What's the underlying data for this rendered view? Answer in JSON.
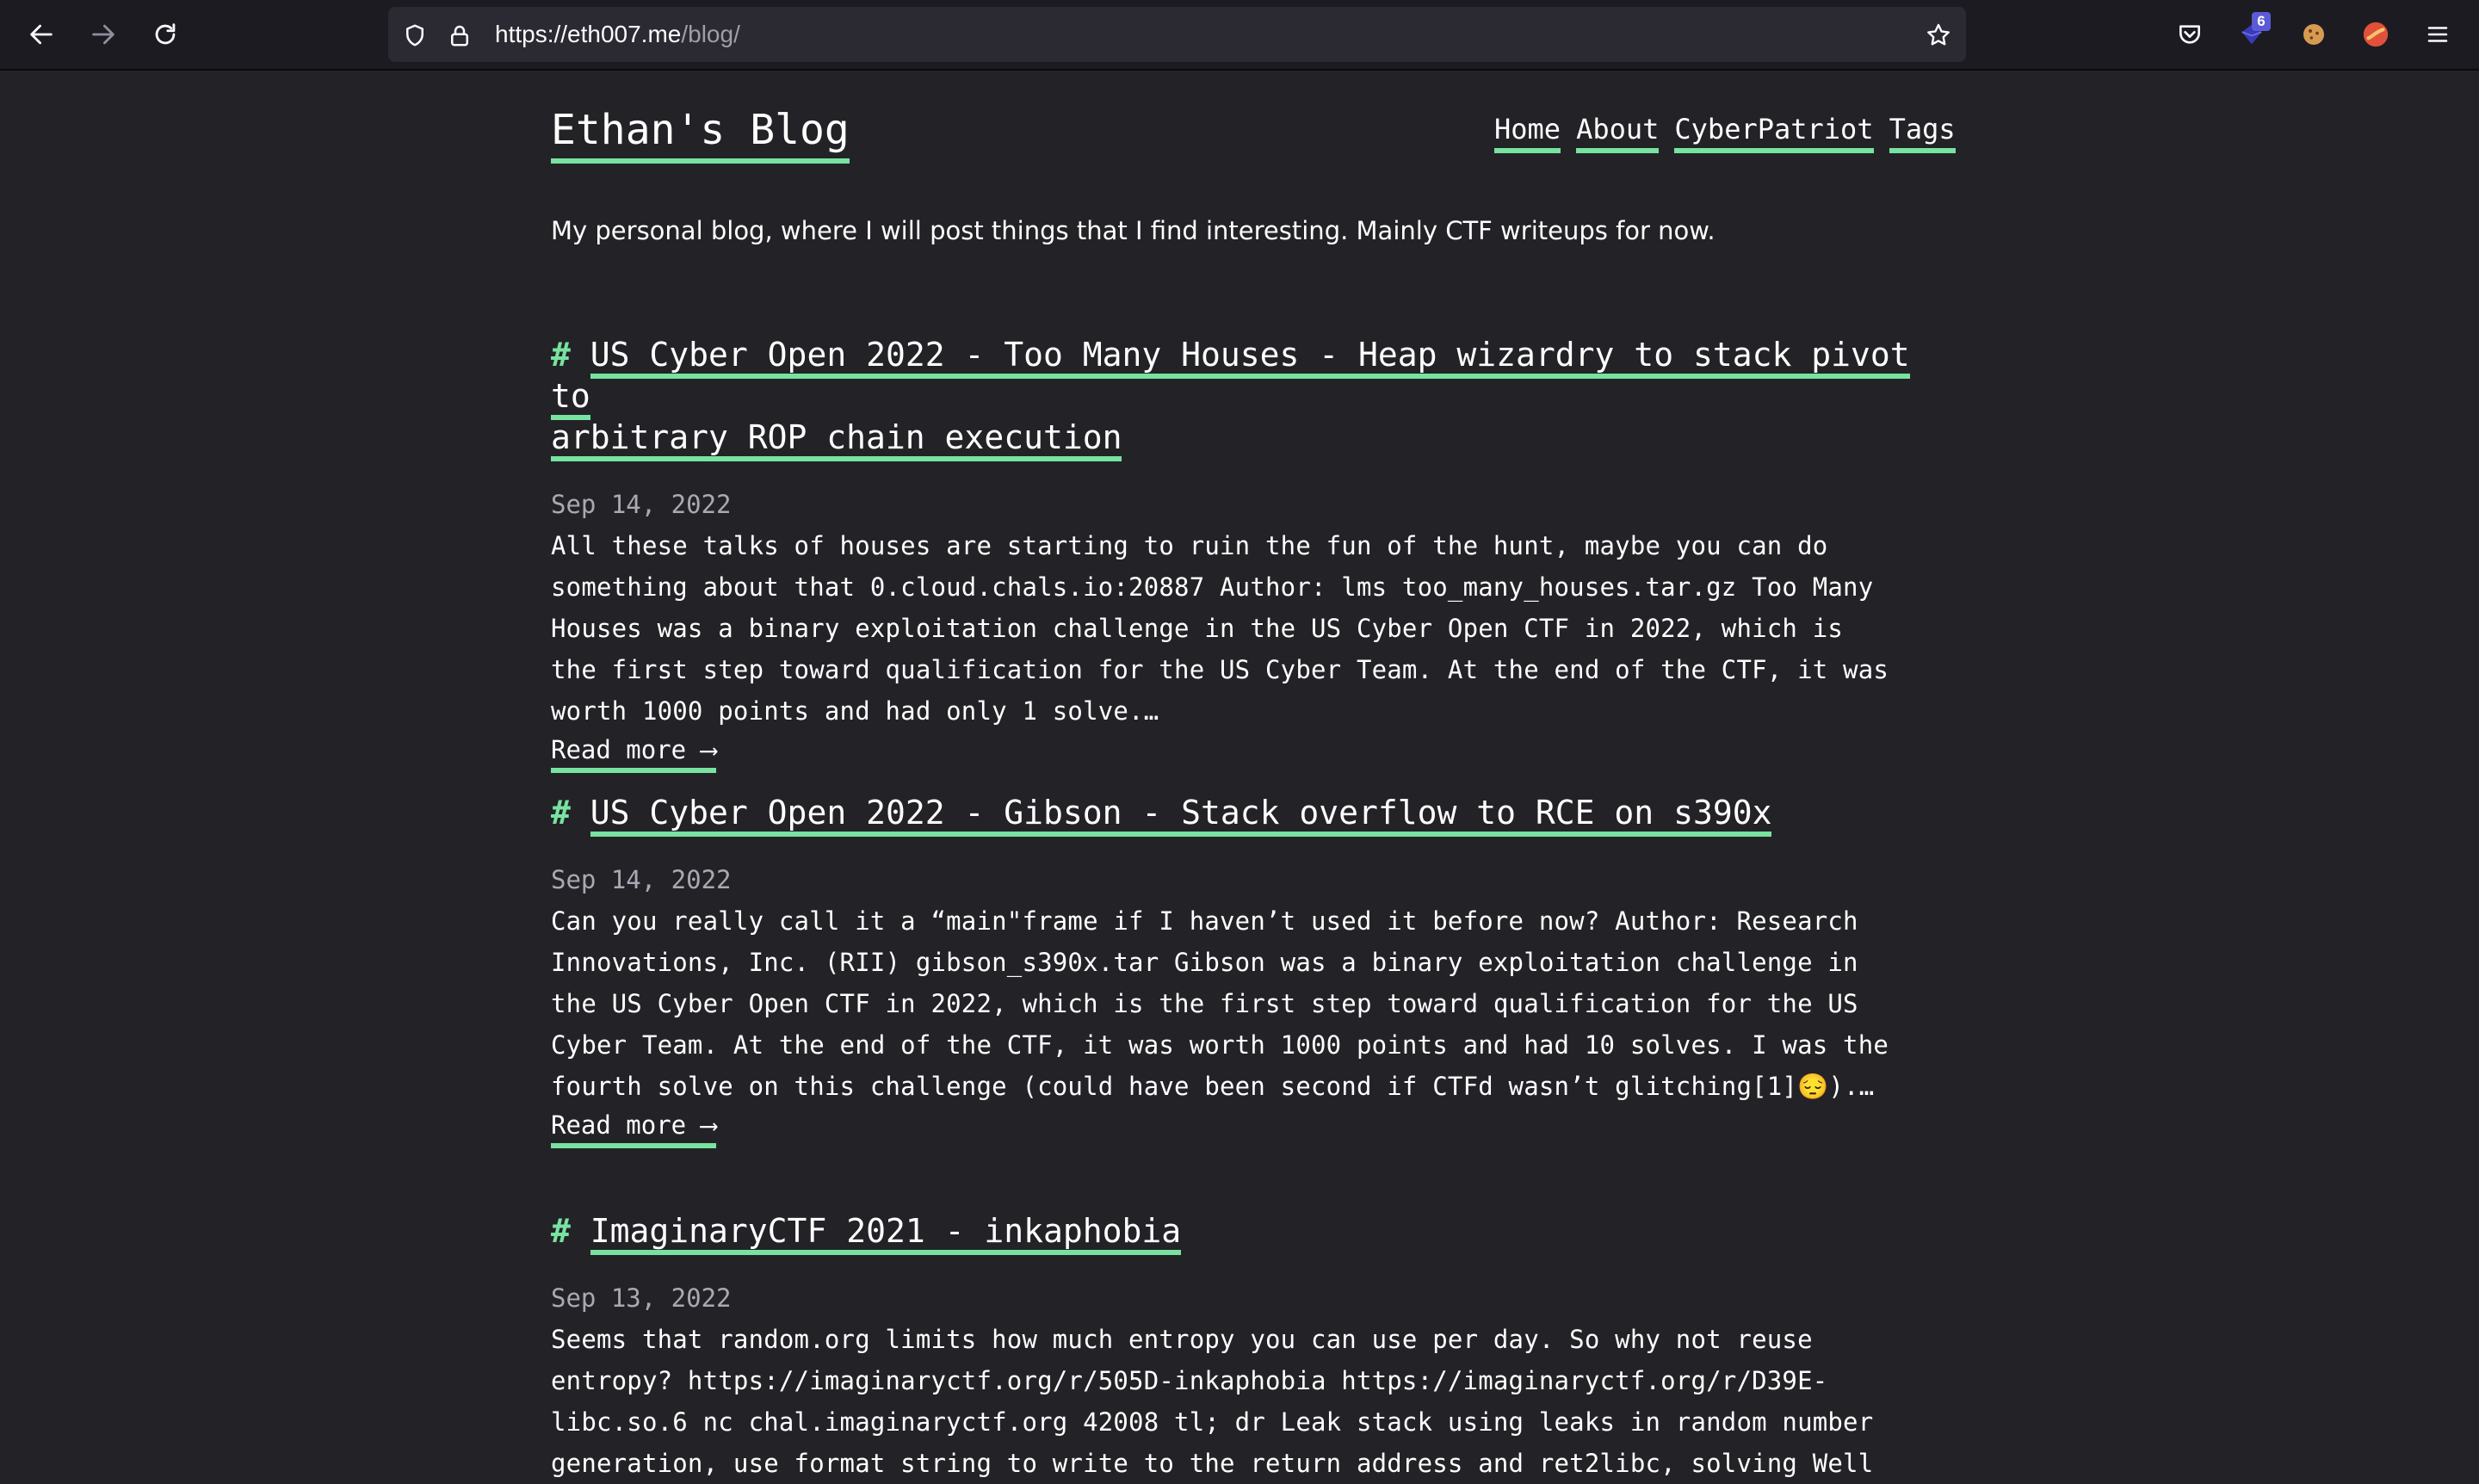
{
  "browser": {
    "url_host": "https://eth007.me",
    "url_path": "/blog/",
    "extension_badge": "6"
  },
  "header": {
    "site_title": "Ethan's Blog",
    "nav": [
      "Home",
      "About",
      "CyberPatriot",
      "Tags"
    ]
  },
  "tagline": "My personal blog, where I will post things that I find interesting. Mainly CTF writeups for now.",
  "posts": [
    {
      "hash": "#",
      "title_line1": "US Cyber Open 2022 - Too Many Houses - Heap wizardry to stack pivot to",
      "title_line2": "arbitrary ROP chain execution",
      "date": "Sep 14, 2022",
      "excerpt": [
        "All these talks of houses are starting to ruin the fun of the hunt, maybe you can do",
        "something about that 0.cloud.chals.io:20887 Author: lms too_many_houses.tar.gz Too Many",
        "Houses was a binary exploitation challenge in the US Cyber Open CTF in 2022, which is",
        "the first step toward qualification for the US Cyber Team. At the end of the CTF, it was",
        "worth 1000 points and had only 1 solve.…"
      ],
      "read_more": "Read more ⟶"
    },
    {
      "hash": "#",
      "title_line1": "US Cyber Open 2022 - Gibson - Stack overflow to RCE on s390x",
      "date": "Sep 14, 2022",
      "excerpt": [
        "Can you really call it a “main\"frame if I haven’t used it before now? Author: Research",
        "Innovations, Inc. (RII) gibson_s390x.tar Gibson was a binary exploitation challenge in",
        "the US Cyber Open CTF in 2022, which is the first step toward qualification for the US",
        "Cyber Team. At the end of the CTF, it was worth 1000 points and had 10 solves. I was the",
        "fourth solve on this challenge (could have been second if CTFd wasn’t glitching[1]😔).…"
      ],
      "read_more": "Read more ⟶"
    },
    {
      "hash": "#",
      "title_line1": "ImaginaryCTF 2021 - inkaphobia",
      "date": "Sep 13, 2022",
      "excerpt": [
        "Seems that random.org limits how much entropy you can use per day. So why not reuse",
        "entropy? https://imaginaryctf.org/r/505D-inkaphobia https://imaginaryctf.org/r/D39E-",
        "libc.so.6 nc chal.imaginaryctf.org 42008 tl; dr Leak stack using leaks in random number",
        "generation, use format string to write to the return address and ret2libc, solving Well"
      ]
    }
  ]
}
